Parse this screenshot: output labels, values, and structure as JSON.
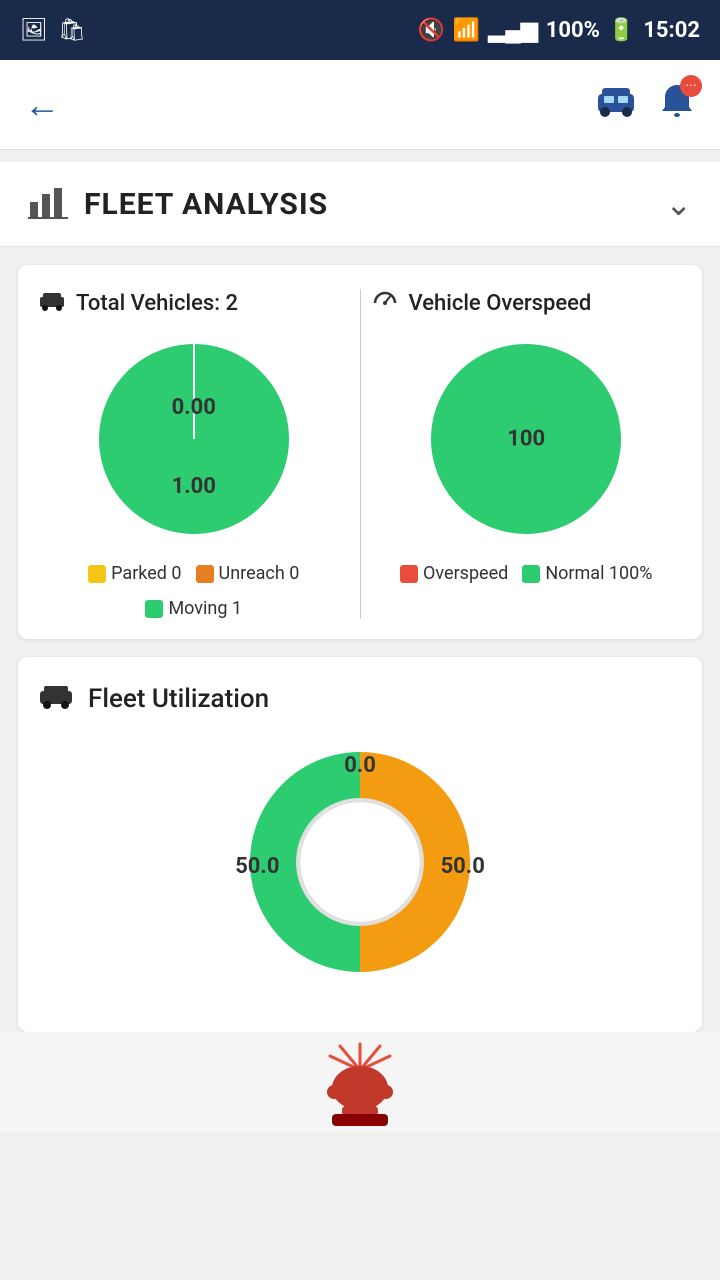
{
  "statusBar": {
    "time": "15:02",
    "battery": "100%",
    "signal": "▂▄▆█"
  },
  "navBar": {
    "backLabel": "←",
    "carIcon": "🚗",
    "bellIcon": "🔔",
    "notifCount": "•••"
  },
  "fleetAnalysis": {
    "title": "FLEET ANALYSIS",
    "chevron": "∨",
    "chartIcon": "📊",
    "totalVehicles": {
      "label": "Total Vehicles: 2",
      "value1": "0.00",
      "value2": "1.00",
      "legend": [
        {
          "color": "#f5c518",
          "label": "Parked 0"
        },
        {
          "color": "#e67e22",
          "label": "Unreach 0"
        },
        {
          "color": "#2ecc71",
          "label": "Moving 1"
        }
      ]
    },
    "vehicleOverspeed": {
      "label": "Vehicle Overspeed",
      "value1": "100",
      "legend": [
        {
          "color": "#e74c3c",
          "label": "Overspeed"
        },
        {
          "color": "#2ecc71",
          "label": "Normal 100%"
        }
      ]
    }
  },
  "fleetUtilization": {
    "label": "Fleet Utilization",
    "carIcon": "🚗",
    "centerLabel": "0.0",
    "leftLabel": "50.0",
    "rightLabel": "50.0",
    "segments": [
      {
        "color": "#2ecc71",
        "value": 50
      },
      {
        "color": "#f39c12",
        "value": 50
      }
    ]
  }
}
